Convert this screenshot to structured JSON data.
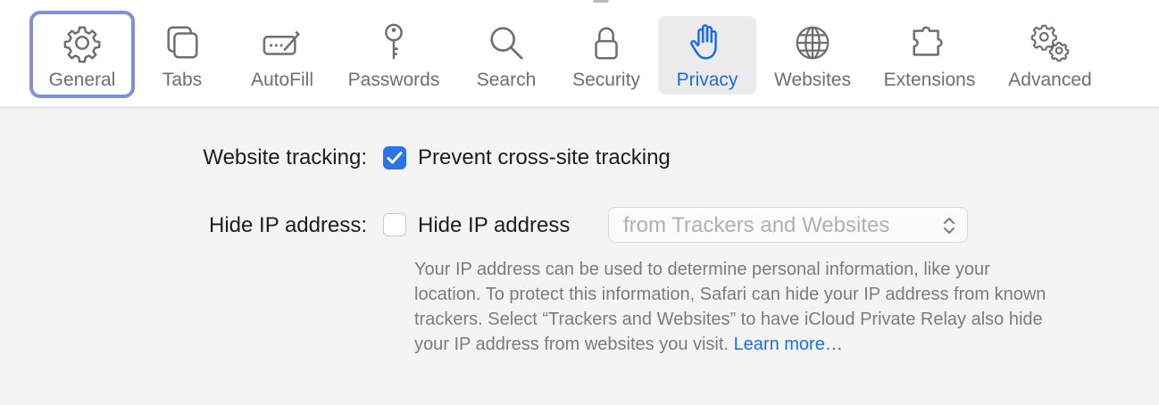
{
  "toolbar": {
    "tabs": [
      {
        "label": "General",
        "icon": "gear-icon"
      },
      {
        "label": "Tabs",
        "icon": "tabs-icon"
      },
      {
        "label": "AutoFill",
        "icon": "autofill-icon"
      },
      {
        "label": "Passwords",
        "icon": "key-icon"
      },
      {
        "label": "Search",
        "icon": "magnifier-icon"
      },
      {
        "label": "Security",
        "icon": "lock-icon"
      },
      {
        "label": "Privacy",
        "icon": "hand-icon"
      },
      {
        "label": "Websites",
        "icon": "globe-icon"
      },
      {
        "label": "Extensions",
        "icon": "puzzle-icon"
      },
      {
        "label": "Advanced",
        "icon": "gears-icon"
      }
    ],
    "selected_tab": "Privacy",
    "focused_tab": "General"
  },
  "privacy": {
    "website_tracking": {
      "label": "Website tracking:",
      "option_label": "Prevent cross-site tracking",
      "checked": true
    },
    "hide_ip": {
      "label": "Hide IP address:",
      "option_label": "Hide IP address",
      "checked": false,
      "select_value": "from Trackers and Websites"
    },
    "description": "Your IP address can be used to determine personal information, like your location. To protect this information, Safari can hide your IP address from known trackers. Select “Trackers and Websites” to have iCloud Private Relay also hide your IP address from websites you visit.",
    "learn_more": "Learn more…"
  },
  "colors": {
    "accent": "#1d6ee6",
    "checkbox_checked": "#2a74e8",
    "focus_ring": "#7f8fe0",
    "secondary_text": "#7c7c80"
  }
}
